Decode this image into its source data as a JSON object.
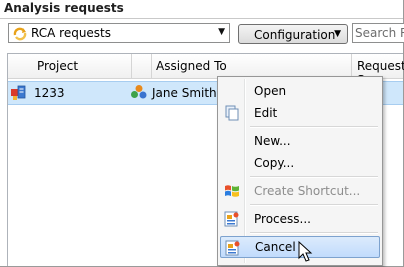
{
  "panel": {
    "title": "Analysis requests"
  },
  "toolbar": {
    "filter_value": "RCA requests",
    "configuration_label": "Configuration",
    "search_placeholder": "Search RCA"
  },
  "grid": {
    "columns": [
      "Project",
      "Assigned To",
      "Request S"
    ],
    "rows": [
      {
        "project": "1233",
        "assigned_to": "Jane Smith"
      }
    ]
  },
  "context_menu": {
    "items": [
      {
        "label": "Open",
        "icon": "none",
        "enabled": true
      },
      {
        "label": "Edit",
        "icon": "documents-icon",
        "enabled": true
      },
      {
        "label": "New...",
        "icon": "none",
        "enabled": true
      },
      {
        "label": "Copy...",
        "icon": "none",
        "enabled": true
      },
      {
        "label": "Create Shortcut...",
        "icon": "windows-logo-icon",
        "enabled": false
      },
      {
        "label": "Process...",
        "icon": "process-form-icon",
        "enabled": true
      },
      {
        "label": "Cancel",
        "icon": "cancel-form-icon",
        "enabled": true,
        "highlighted": true
      }
    ]
  }
}
